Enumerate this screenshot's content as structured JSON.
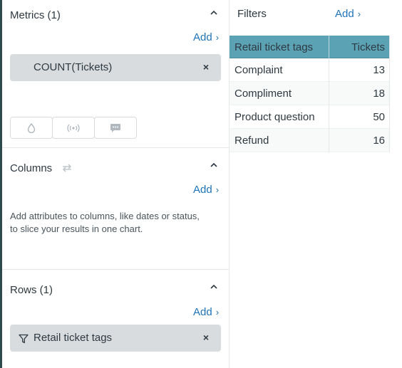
{
  "metrics": {
    "title": "Metrics (1)",
    "add_label": "Add",
    "pill_label": "COUNT(Tickets)",
    "remove_symbol": "×",
    "icon_buttons": [
      "drop-icon",
      "broadcast-icon",
      "speech-bubble-icon"
    ]
  },
  "columns": {
    "title": "Columns",
    "add_label": "Add",
    "helper_text": "Add attributes to columns, like dates or status, to slice your results in one chart."
  },
  "rows": {
    "title": "Rows (1)",
    "add_label": "Add",
    "pill_label": "Retail ticket tags",
    "remove_symbol": "×"
  },
  "filters": {
    "title": "Filters",
    "add_label": "Add"
  },
  "table": {
    "headers": [
      "Retail ticket tags",
      "Tickets"
    ],
    "rows": [
      {
        "label": "Complaint",
        "value": "13"
      },
      {
        "label": "Compliment",
        "value": "18"
      },
      {
        "label": "Product question",
        "value": "50"
      },
      {
        "label": "Refund",
        "value": "16"
      }
    ]
  },
  "colors": {
    "accent": "#1f73b7",
    "header_bg": "#5ba3b4",
    "pill_bg": "#d8dcde"
  }
}
